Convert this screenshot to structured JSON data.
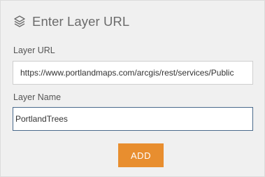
{
  "panel": {
    "title": "Enter Layer URL",
    "title_icon": "layers-icon"
  },
  "fields": {
    "url": {
      "label": "Layer URL",
      "value": "https://www.portlandmaps.com/arcgis/rest/services/Public"
    },
    "name": {
      "label": "Layer Name",
      "value": "PortlandTrees"
    }
  },
  "actions": {
    "add_label": "ADD"
  },
  "colors": {
    "panel_background": "#f0f0f0",
    "add_button": "#e88e2f",
    "focused_border": "#4a6a8c"
  }
}
